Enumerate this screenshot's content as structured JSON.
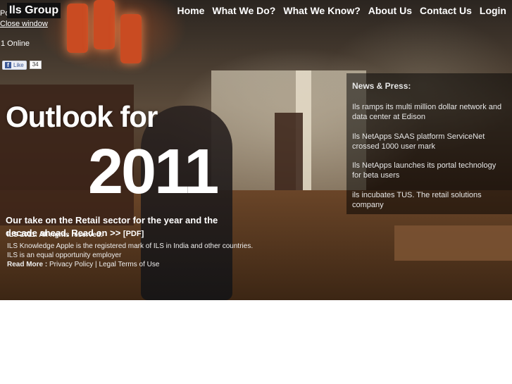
{
  "brand": {
    "logo_text": "Ils Group",
    "truncated_text": "Po"
  },
  "window": {
    "close_label": "Close window"
  },
  "status": {
    "online": "1 Online"
  },
  "facebook": {
    "like_label": "Like",
    "count": "34"
  },
  "nav": {
    "items": [
      {
        "label": "Home"
      },
      {
        "label": "What We Do?"
      },
      {
        "label": "What We Know?"
      },
      {
        "label": "About Us"
      },
      {
        "label": "Contact Us"
      },
      {
        "label": "Login"
      }
    ]
  },
  "news": {
    "title": "News & Press:",
    "items": [
      {
        "text": "Ils ramps its multi million dollar network and data center at Edison"
      },
      {
        "text": "Ils NetApps SAAS platform ServiceNet crossed 1000 user mark"
      },
      {
        "text": "Ils NetApps launches its portal technology for beta users"
      },
      {
        "text": "ils incubates TUS. The retail solutions company"
      }
    ]
  },
  "hero": {
    "headline_line1": "Outlook for",
    "headline_year": "2011",
    "tagline": "Our take on the Retail sector for the year and the decade ahead. Read on >>",
    "pdf_label": "[PDF]"
  },
  "footer": {
    "copyright": "ILS 2011. All rights reserved.",
    "trademark": "ILS Knowledge Apple is the registered mark of ILS in India and other countries.",
    "employer": "ILS is an equal opportunity employer",
    "read_more": "Read More :",
    "privacy": "Privacy Policy",
    "separator": "|",
    "legal": "Legal Terms of Use"
  }
}
